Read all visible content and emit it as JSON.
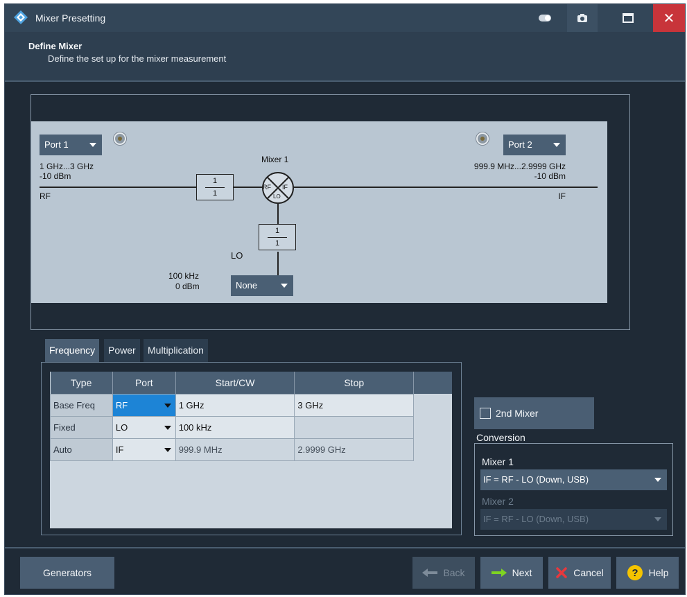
{
  "window": {
    "title": "Mixer Presetting"
  },
  "header": {
    "title": "Define Mixer",
    "subtitle": "Define the set up for the mixer measurement"
  },
  "diagram": {
    "rf_port": {
      "selected": "Port 1",
      "freq": "1 GHz...3 GHz",
      "power": "-10 dBm",
      "label": "RF"
    },
    "if_port": {
      "selected": "Port 2",
      "freq": "999.9 MHz...2.9999 GHz",
      "power": "-10 dBm",
      "label": "IF"
    },
    "mixer": {
      "label": "Mixer 1",
      "rf": "RF",
      "if": "IF",
      "lo": "LO"
    },
    "rf_multiplier": {
      "num": "1",
      "den": "1"
    },
    "lo_multiplier": {
      "num": "1",
      "den": "1"
    },
    "lo_port": {
      "label": "LO",
      "selected": "None",
      "freq": "100 kHz",
      "power": "0 dBm"
    }
  },
  "tabs": [
    {
      "label": "Frequency",
      "active": true
    },
    {
      "label": "Power",
      "active": false
    },
    {
      "label": "Multiplication",
      "active": false
    }
  ],
  "freq_table": {
    "columns": [
      "Type",
      "Port",
      "Start/CW",
      "Stop"
    ],
    "rows": [
      {
        "type": "Base Freq",
        "port": "RF",
        "start": "1 GHz",
        "stop": "3 GHz"
      },
      {
        "type": "Fixed",
        "port": "LO",
        "start": "100 kHz",
        "stop": ""
      },
      {
        "type": "Auto",
        "port": "IF",
        "start": "999.9 MHz",
        "stop": "2.9999 GHz"
      }
    ]
  },
  "second_mixer": {
    "label": "2nd Mixer",
    "checked": false
  },
  "conversion": {
    "label": "Conversion",
    "mixer1_label": "Mixer 1",
    "mixer1_value": "IF = RF - LO (Down, USB)",
    "mixer2_label": "Mixer 2",
    "mixer2_value": "IF = RF - LO (Down, USB)"
  },
  "footer": {
    "generators": "Generators",
    "back": "Back",
    "next": "Next",
    "cancel": "Cancel",
    "help": "Help"
  },
  "icons": {
    "app": "rs-logo-icon",
    "toggle": "toggle-icon",
    "camera": "camera-icon",
    "maximize": "maximize-icon",
    "close": "close-icon",
    "back": "arrow-left-icon",
    "next": "arrow-right-icon",
    "cancel": "x-icon",
    "help": "question-icon"
  },
  "colors": {
    "accent_selected": "#1d84d6",
    "close_button": "#c8343a",
    "next_arrow": "#7ed321",
    "cancel_x": "#e8383d",
    "help_circle": "#f5c400"
  }
}
